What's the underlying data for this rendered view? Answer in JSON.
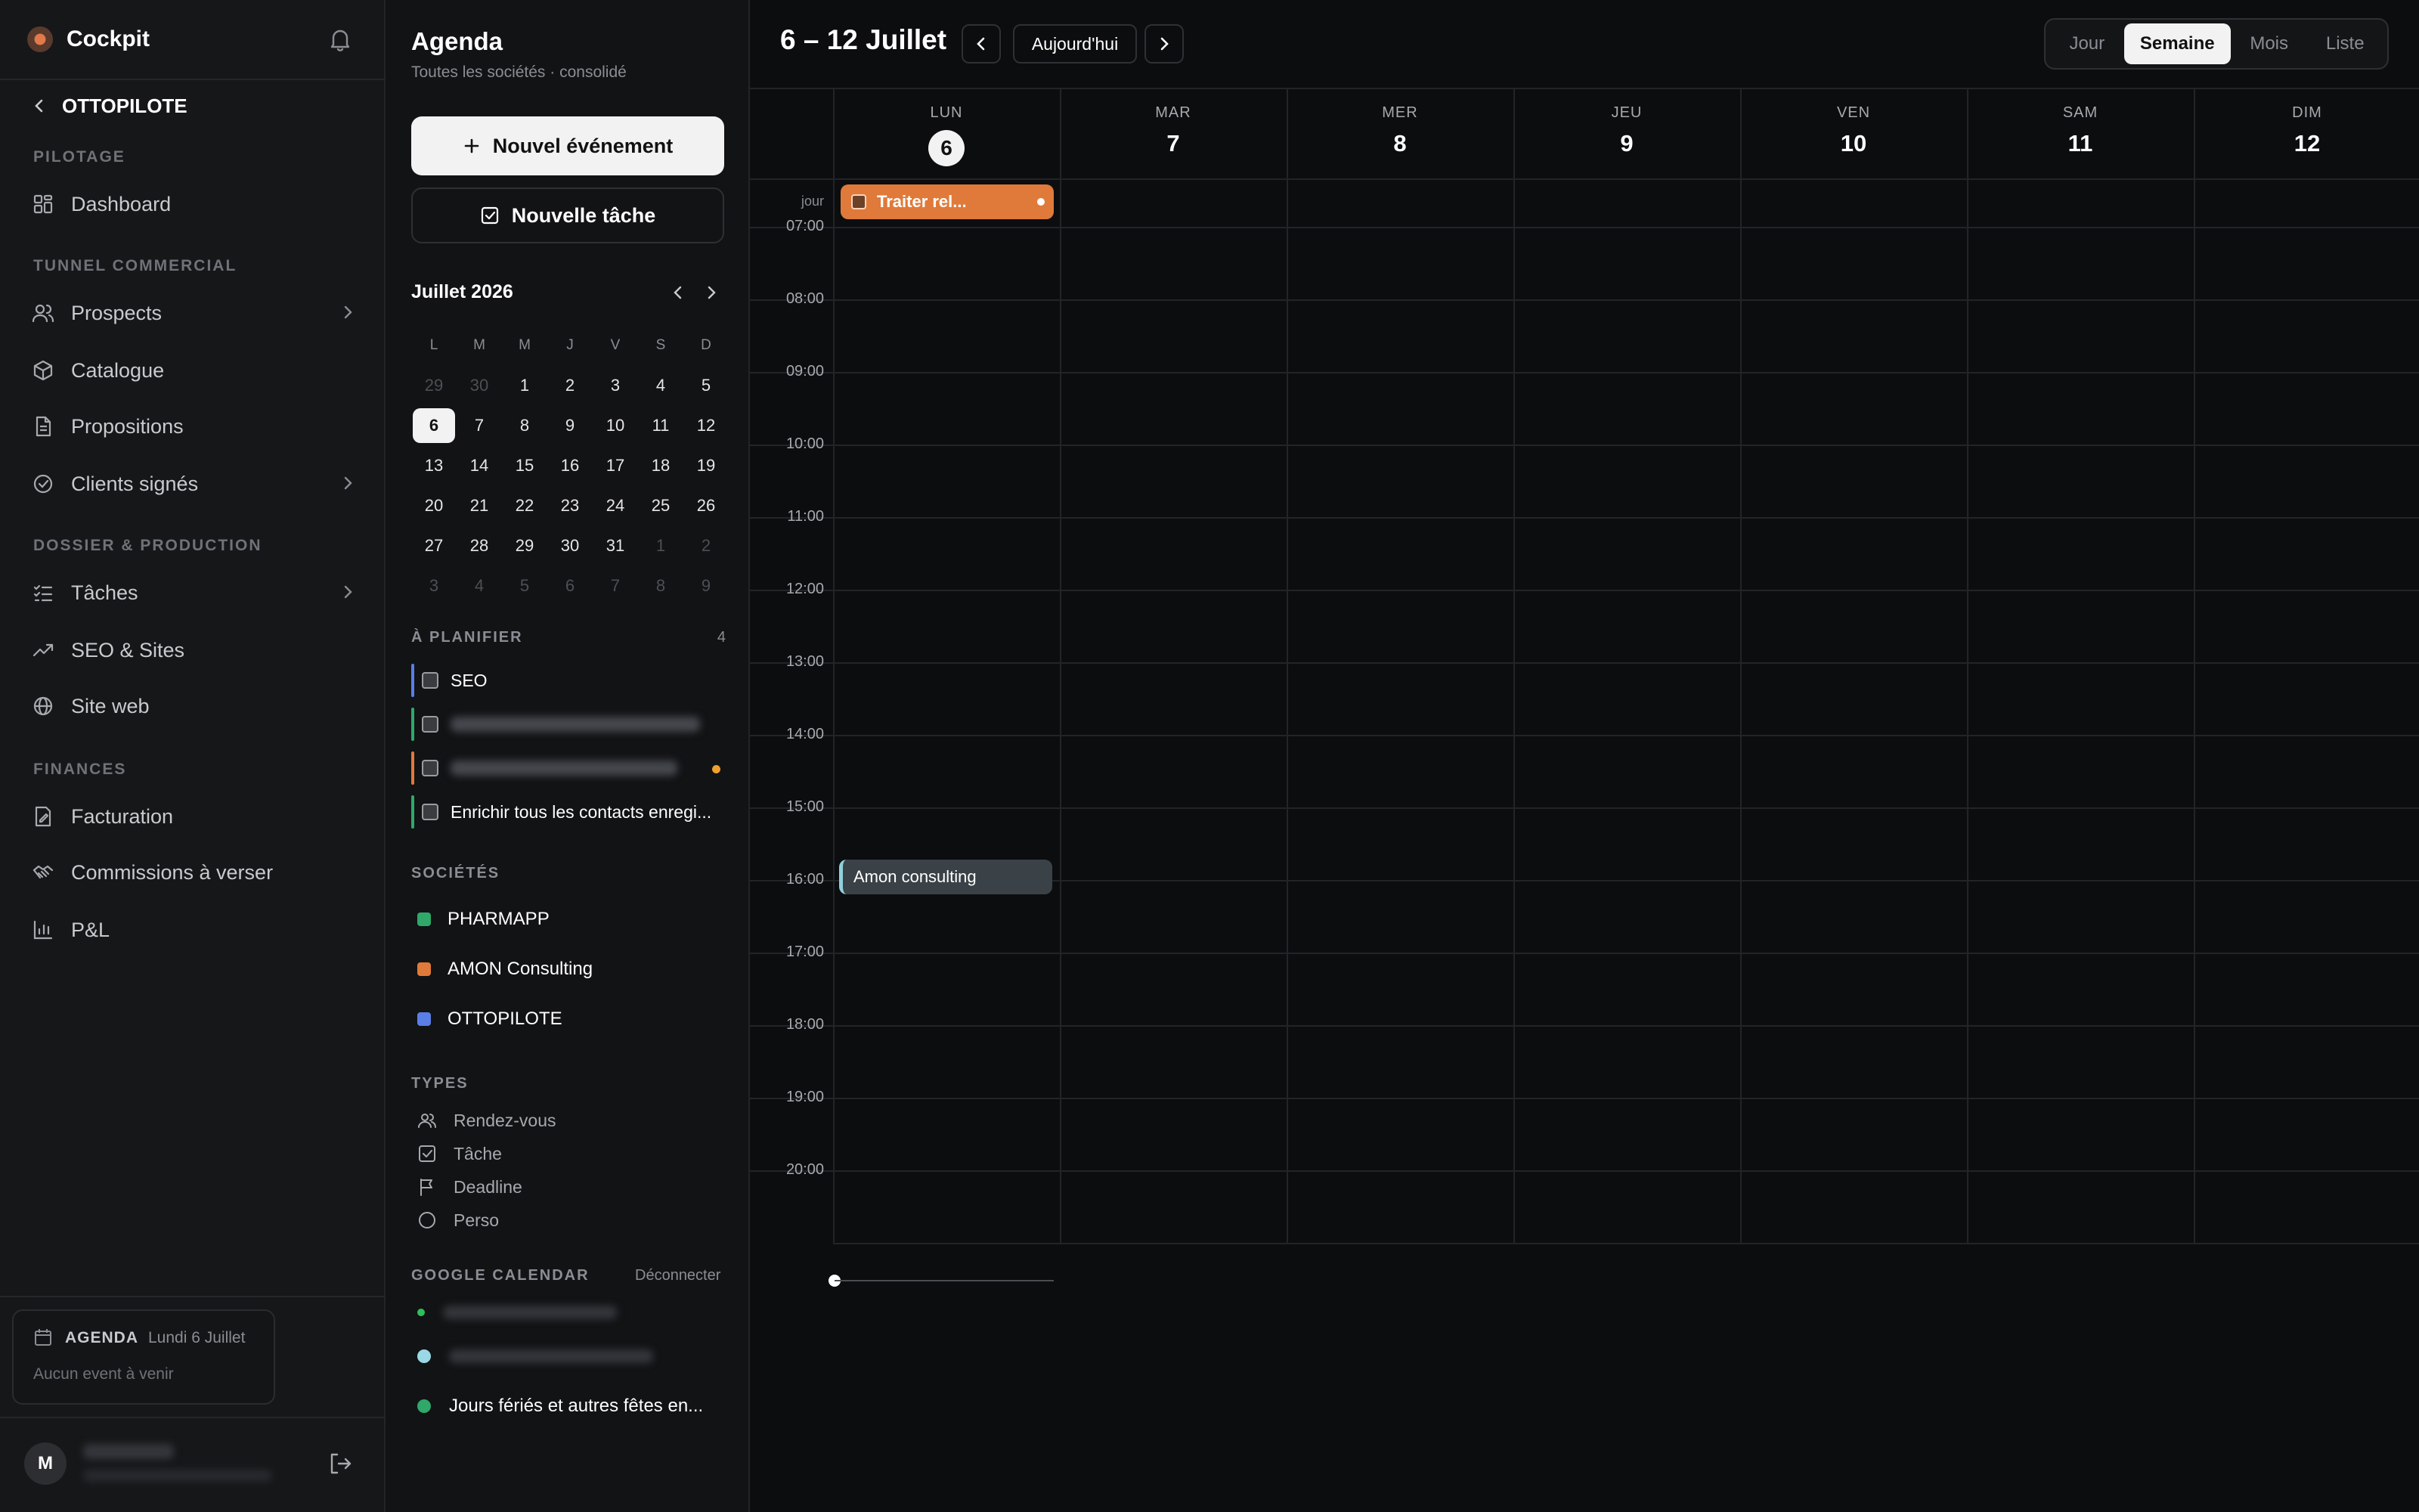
{
  "sidebar": {
    "brand": "Cockpit",
    "back_label": "OTTOPILOTE",
    "sections": {
      "pilotage": "PILOTAGE",
      "tunnel": "TUNNEL COMMERCIAL",
      "dossier": "DOSSIER & PRODUCTION",
      "finances": "FINANCES"
    },
    "items": [
      {
        "label": "Dashboard",
        "icon": "grid-icon"
      },
      {
        "label": "Prospects",
        "icon": "users-icon"
      },
      {
        "label": "Catalogue",
        "icon": "box-icon"
      },
      {
        "label": "Propositions",
        "icon": "document-icon"
      },
      {
        "label": "Clients signés",
        "icon": "check-circle-icon"
      },
      {
        "label": "Tâches",
        "icon": "checklist-icon"
      },
      {
        "label": "SEO & Sites",
        "icon": "trending-up-icon"
      },
      {
        "label": "Site web",
        "icon": "globe-icon"
      },
      {
        "label": "Facturation",
        "icon": "invoice-icon"
      },
      {
        "label": "Commissions à verser",
        "icon": "handshake-icon"
      },
      {
        "label": "P&L",
        "icon": "bar-chart-icon"
      }
    ],
    "agenda_card": {
      "title": "AGENDA",
      "date": "Lundi 6 Juillet",
      "empty": "Aucun event à venir"
    },
    "user_initial": "M"
  },
  "panel": {
    "title": "Agenda",
    "subtitle": "Toutes les sociétés · consolidé",
    "new_event": "Nouvel événement",
    "new_task": "Nouvelle tâche",
    "mini_calendar": {
      "month_label": "Juillet 2026",
      "weekdays": [
        "L",
        "M",
        "M",
        "J",
        "V",
        "S",
        "D"
      ],
      "weeks": [
        [
          "29",
          "30",
          "1",
          "2",
          "3",
          "4",
          "5"
        ],
        [
          "6",
          "7",
          "8",
          "9",
          "10",
          "11",
          "12"
        ],
        [
          "13",
          "14",
          "15",
          "16",
          "17",
          "18",
          "19"
        ],
        [
          "20",
          "21",
          "22",
          "23",
          "24",
          "25",
          "26"
        ],
        [
          "27",
          "28",
          "29",
          "30",
          "31",
          "1",
          "2"
        ],
        [
          "3",
          "4",
          "5",
          "6",
          "7",
          "8",
          "9"
        ]
      ],
      "selected": "6"
    },
    "to_plan": {
      "label": "À PLANIFIER",
      "count": "4",
      "items": [
        {
          "label": "SEO",
          "color": "#5b7ee6"
        },
        {
          "label": "",
          "color": "#2fa86a"
        },
        {
          "label": "",
          "color": "#e07a3a"
        },
        {
          "label": "Enrichir tous les contacts enregi...",
          "color": "#2fa86a"
        }
      ]
    },
    "companies": {
      "label": "SOCIÉTÉS",
      "items": [
        {
          "name": "PHARMAPP",
          "color": "#2fa86a"
        },
        {
          "name": "AMON Consulting",
          "color": "#e07a3a"
        },
        {
          "name": "OTTOPILOTE",
          "color": "#5b7ee6"
        }
      ]
    },
    "types": {
      "label": "TYPES",
      "items": [
        {
          "label": "Rendez-vous",
          "icon": "users-icon"
        },
        {
          "label": "Tâche",
          "icon": "checkbox-icon"
        },
        {
          "label": "Deadline",
          "icon": "flag-icon"
        },
        {
          "label": "Perso",
          "icon": "circle-icon"
        }
      ]
    },
    "google": {
      "label": "GOOGLE CALENDAR",
      "disconnect": "Déconnecter",
      "items": [
        {
          "label": "",
          "color": "#2fbf5a"
        },
        {
          "label": "",
          "color": "#9ad8e6"
        },
        {
          "label": "Jours fériés et autres fêtes en...",
          "color": "#2fa86a"
        }
      ]
    }
  },
  "calendar": {
    "range_title": "6 – 12 Juillet",
    "today_button": "Aujourd'hui",
    "views": [
      "Jour",
      "Semaine",
      "Mois",
      "Liste"
    ],
    "active_view": "Semaine",
    "allday_label": "jour",
    "days": [
      {
        "name": "LUN",
        "num": "6"
      },
      {
        "name": "MAR",
        "num": "7"
      },
      {
        "name": "MER",
        "num": "8"
      },
      {
        "name": "JEU",
        "num": "9"
      },
      {
        "name": "VEN",
        "num": "10"
      },
      {
        "name": "SAM",
        "num": "11"
      },
      {
        "name": "DIM",
        "num": "12"
      }
    ],
    "hours": [
      "07:00",
      "08:00",
      "09:00",
      "10:00",
      "11:00",
      "12:00",
      "13:00",
      "14:00",
      "15:00",
      "16:00",
      "17:00",
      "18:00",
      "19:00",
      "20:00"
    ],
    "events": {
      "allday": {
        "title": "Traiter rel...",
        "color": "#e07a3a"
      },
      "timed": {
        "title": "Amon consulting",
        "start": "15:00",
        "color": "#8fd0dc"
      }
    }
  }
}
